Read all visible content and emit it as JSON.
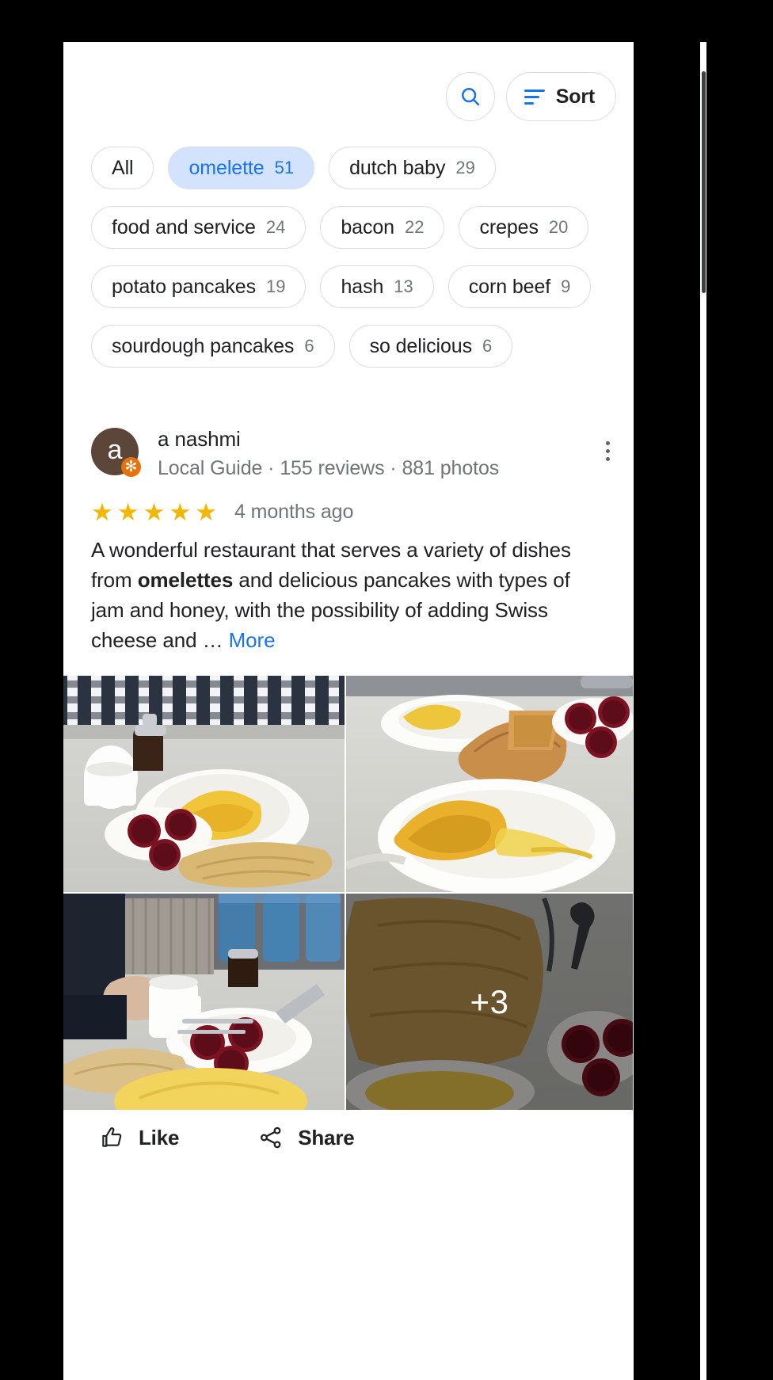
{
  "toolbar": {
    "search_icon": "search-icon",
    "sort_icon": "sort-icon",
    "sort_label": "Sort"
  },
  "chips": [
    {
      "label": "All",
      "count": "",
      "selected": false
    },
    {
      "label": "omelette",
      "count": "51",
      "selected": true
    },
    {
      "label": "dutch baby",
      "count": "29",
      "selected": false
    },
    {
      "label": "food and service",
      "count": "24",
      "selected": false
    },
    {
      "label": "bacon",
      "count": "22",
      "selected": false
    },
    {
      "label": "crepes",
      "count": "20",
      "selected": false
    },
    {
      "label": "potato pancakes",
      "count": "19",
      "selected": false
    },
    {
      "label": "hash",
      "count": "13",
      "selected": false
    },
    {
      "label": "corn beef",
      "count": "9",
      "selected": false
    },
    {
      "label": "sourdough pancakes",
      "count": "6",
      "selected": false
    },
    {
      "label": "so delicious",
      "count": "6",
      "selected": false
    }
  ],
  "review": {
    "avatar_initial": "a",
    "local_guide_badge": "✻",
    "author": "a nashmi",
    "meta": "Local Guide · 155 reviews · 881 photos",
    "stars": 5,
    "star_glyph": "★",
    "date": "4 months ago",
    "text_part1": "A wonderful restaurant that serves a variety of dishes from ",
    "text_bold": "omelettes",
    "text_part2": " and delicious pancakes with types of jam and honey, with the possibility of adding Swiss cheese and … ",
    "more_label": "More",
    "overflow_menu": "more-options-icon"
  },
  "photos": [
    {
      "name": "review-photo-1",
      "overlay": ""
    },
    {
      "name": "review-photo-2",
      "overlay": ""
    },
    {
      "name": "review-photo-3",
      "overlay": ""
    },
    {
      "name": "review-photo-4",
      "overlay": "+3"
    }
  ],
  "actions": {
    "like_label": "Like",
    "like_icon": "thumbs-up-icon",
    "share_label": "Share",
    "share_icon": "share-icon"
  },
  "colors": {
    "accent_blue": "#1a73e8",
    "chip_selected_bg": "#d3e3fd",
    "star_gold": "#f2b705",
    "avatar_brown": "#5c4539",
    "badge_orange": "#e8710a",
    "text_primary": "#202124",
    "text_secondary": "#70757a",
    "border_gray": "#dadce0"
  }
}
